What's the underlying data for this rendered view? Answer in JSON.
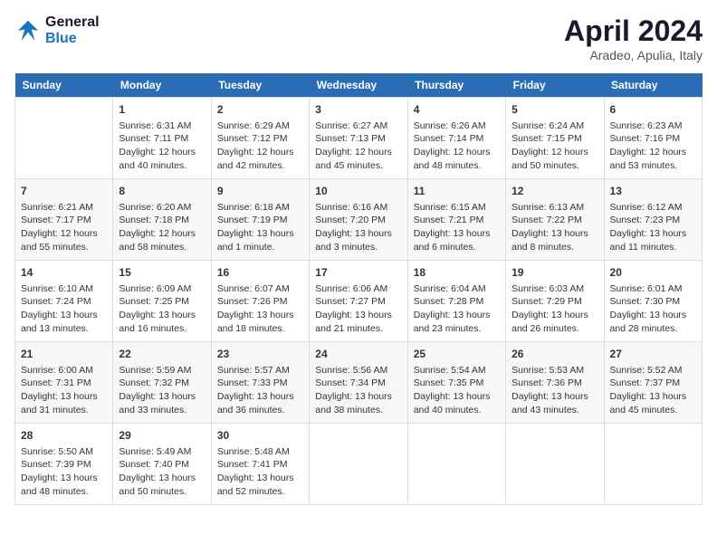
{
  "header": {
    "logo_line1": "General",
    "logo_line2": "Blue",
    "month": "April 2024",
    "location": "Aradeo, Apulia, Italy"
  },
  "days_of_week": [
    "Sunday",
    "Monday",
    "Tuesday",
    "Wednesday",
    "Thursday",
    "Friday",
    "Saturday"
  ],
  "weeks": [
    [
      {
        "day": null
      },
      {
        "day": "1",
        "sunrise": "6:31 AM",
        "sunset": "7:11 PM",
        "daylight": "12 hours and 40 minutes."
      },
      {
        "day": "2",
        "sunrise": "6:29 AM",
        "sunset": "7:12 PM",
        "daylight": "12 hours and 42 minutes."
      },
      {
        "day": "3",
        "sunrise": "6:27 AM",
        "sunset": "7:13 PM",
        "daylight": "12 hours and 45 minutes."
      },
      {
        "day": "4",
        "sunrise": "6:26 AM",
        "sunset": "7:14 PM",
        "daylight": "12 hours and 48 minutes."
      },
      {
        "day": "5",
        "sunrise": "6:24 AM",
        "sunset": "7:15 PM",
        "daylight": "12 hours and 50 minutes."
      },
      {
        "day": "6",
        "sunrise": "6:23 AM",
        "sunset": "7:16 PM",
        "daylight": "12 hours and 53 minutes."
      }
    ],
    [
      {
        "day": "7",
        "sunrise": "6:21 AM",
        "sunset": "7:17 PM",
        "daylight": "12 hours and 55 minutes."
      },
      {
        "day": "8",
        "sunrise": "6:20 AM",
        "sunset": "7:18 PM",
        "daylight": "12 hours and 58 minutes."
      },
      {
        "day": "9",
        "sunrise": "6:18 AM",
        "sunset": "7:19 PM",
        "daylight": "13 hours and 1 minute."
      },
      {
        "day": "10",
        "sunrise": "6:16 AM",
        "sunset": "7:20 PM",
        "daylight": "13 hours and 3 minutes."
      },
      {
        "day": "11",
        "sunrise": "6:15 AM",
        "sunset": "7:21 PM",
        "daylight": "13 hours and 6 minutes."
      },
      {
        "day": "12",
        "sunrise": "6:13 AM",
        "sunset": "7:22 PM",
        "daylight": "13 hours and 8 minutes."
      },
      {
        "day": "13",
        "sunrise": "6:12 AM",
        "sunset": "7:23 PM",
        "daylight": "13 hours and 11 minutes."
      }
    ],
    [
      {
        "day": "14",
        "sunrise": "6:10 AM",
        "sunset": "7:24 PM",
        "daylight": "13 hours and 13 minutes."
      },
      {
        "day": "15",
        "sunrise": "6:09 AM",
        "sunset": "7:25 PM",
        "daylight": "13 hours and 16 minutes."
      },
      {
        "day": "16",
        "sunrise": "6:07 AM",
        "sunset": "7:26 PM",
        "daylight": "13 hours and 18 minutes."
      },
      {
        "day": "17",
        "sunrise": "6:06 AM",
        "sunset": "7:27 PM",
        "daylight": "13 hours and 21 minutes."
      },
      {
        "day": "18",
        "sunrise": "6:04 AM",
        "sunset": "7:28 PM",
        "daylight": "13 hours and 23 minutes."
      },
      {
        "day": "19",
        "sunrise": "6:03 AM",
        "sunset": "7:29 PM",
        "daylight": "13 hours and 26 minutes."
      },
      {
        "day": "20",
        "sunrise": "6:01 AM",
        "sunset": "7:30 PM",
        "daylight": "13 hours and 28 minutes."
      }
    ],
    [
      {
        "day": "21",
        "sunrise": "6:00 AM",
        "sunset": "7:31 PM",
        "daylight": "13 hours and 31 minutes."
      },
      {
        "day": "22",
        "sunrise": "5:59 AM",
        "sunset": "7:32 PM",
        "daylight": "13 hours and 33 minutes."
      },
      {
        "day": "23",
        "sunrise": "5:57 AM",
        "sunset": "7:33 PM",
        "daylight": "13 hours and 36 minutes."
      },
      {
        "day": "24",
        "sunrise": "5:56 AM",
        "sunset": "7:34 PM",
        "daylight": "13 hours and 38 minutes."
      },
      {
        "day": "25",
        "sunrise": "5:54 AM",
        "sunset": "7:35 PM",
        "daylight": "13 hours and 40 minutes."
      },
      {
        "day": "26",
        "sunrise": "5:53 AM",
        "sunset": "7:36 PM",
        "daylight": "13 hours and 43 minutes."
      },
      {
        "day": "27",
        "sunrise": "5:52 AM",
        "sunset": "7:37 PM",
        "daylight": "13 hours and 45 minutes."
      }
    ],
    [
      {
        "day": "28",
        "sunrise": "5:50 AM",
        "sunset": "7:39 PM",
        "daylight": "13 hours and 48 minutes."
      },
      {
        "day": "29",
        "sunrise": "5:49 AM",
        "sunset": "7:40 PM",
        "daylight": "13 hours and 50 minutes."
      },
      {
        "day": "30",
        "sunrise": "5:48 AM",
        "sunset": "7:41 PM",
        "daylight": "13 hours and 52 minutes."
      },
      {
        "day": null
      },
      {
        "day": null
      },
      {
        "day": null
      },
      {
        "day": null
      }
    ]
  ],
  "labels": {
    "sunrise_prefix": "Sunrise:",
    "sunset_prefix": "Sunset:",
    "daylight_prefix": "Daylight:"
  }
}
